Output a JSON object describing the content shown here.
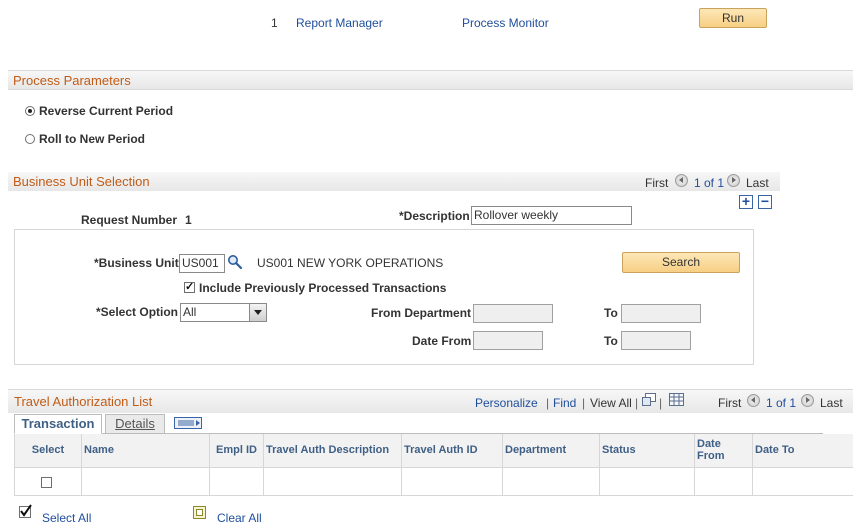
{
  "toolbar": {
    "number": "1",
    "report_manager": "Report Manager",
    "process_monitor": "Process Monitor",
    "run": "Run"
  },
  "process_parameters": {
    "title": "Process Parameters",
    "options": [
      "Reverse Current Period",
      "Roll to New Period"
    ],
    "selected": "Reverse Current Period"
  },
  "business_unit_selection": {
    "title": "Business Unit Selection",
    "nav": {
      "first": "First",
      "range": "1 of 1",
      "last": "Last"
    },
    "request_number_label": "Request Number",
    "request_number_value": "1",
    "description_label": "*Description",
    "description_value": "Rollover weekly",
    "business_unit_label": "*Business Unit",
    "business_unit_value": "US001",
    "business_unit_name": "US001 NEW YORK OPERATIONS",
    "search": "Search",
    "include_processed_label": "Include Previously Processed Transactions",
    "include_processed_checked": true,
    "select_option_label": "*Select Option",
    "select_option_value": "All",
    "from_department_label": "From Department",
    "to_label": "To",
    "date_from_label": "Date From",
    "to_label_2": "To"
  },
  "travel_authorization_list": {
    "title": "Travel Authorization List",
    "links": {
      "personalize": "Personalize",
      "find": "Find",
      "view_all": "View All"
    },
    "separator": "|",
    "nav": {
      "first": "First",
      "range": "1 of 1",
      "last": "Last"
    },
    "tabs": [
      "Transaction",
      "Details"
    ],
    "active_tab": "Transaction",
    "columns": [
      "Select",
      "Name",
      "Empl ID",
      "Travel Auth Description",
      "Travel Auth ID",
      "Department",
      "Status",
      "Date From",
      "Date To"
    ],
    "rows": [
      {
        "selected": false,
        "name": "",
        "empl_id": "",
        "description": "",
        "auth_id": "",
        "department": "",
        "status": "",
        "date_from": "",
        "date_to": ""
      }
    ]
  },
  "footer": {
    "select_all": "Select All",
    "clear_all": "Clear All"
  },
  "colors": {
    "section_title": "#c15c17",
    "link": "#1f4e9c",
    "button": "#f7cf84",
    "grid_header_text": "#3f5f85"
  }
}
